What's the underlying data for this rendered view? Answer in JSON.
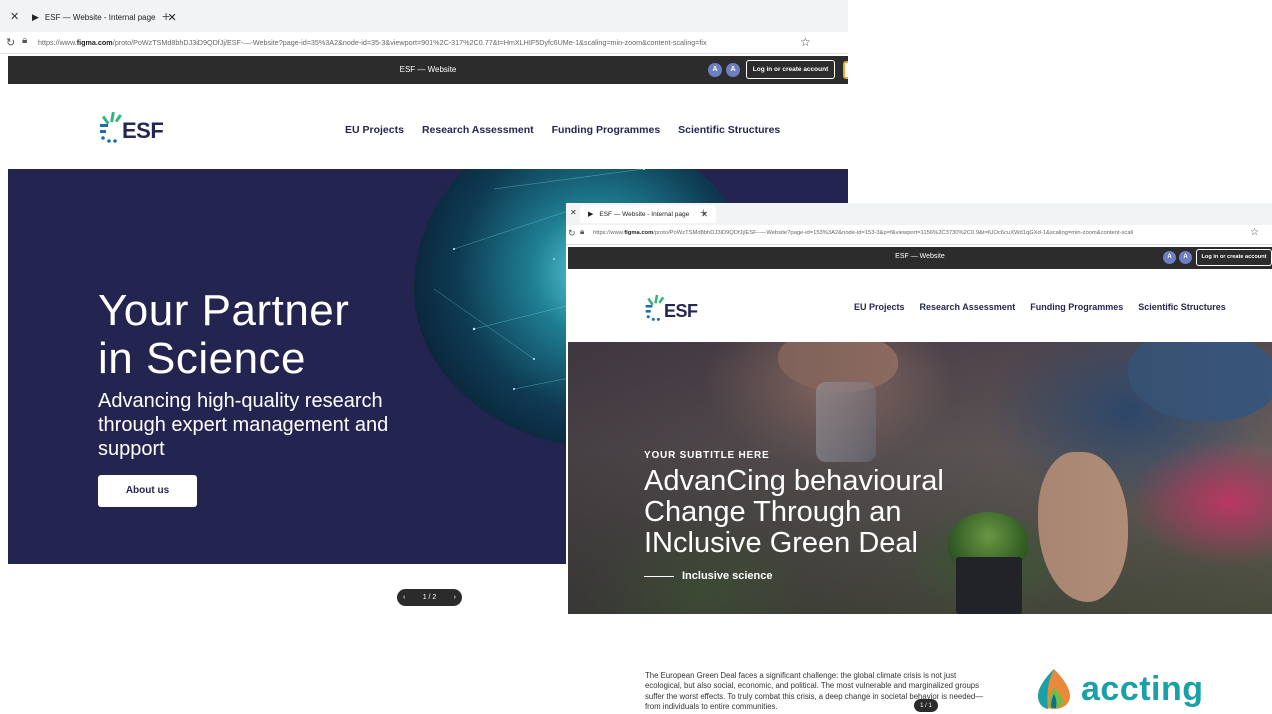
{
  "window1": {
    "tab_title": "ESF — Website - Internal page",
    "url_domain": "figma.com",
    "url_prefix": "https://www.",
    "url_rest": "/proto/PoWzTSMd8bhDJ3iD9QDfJj/ESF-—-Website?page-id=35%3A2&node-id=35-3&viewport=901%2C-317%2C0.77&t=HmXLHIF5Dyfc6UMe-1&scaling=min-zoom&content-scaling=fix",
    "figma_title": "ESF — Website",
    "avatars": [
      "A",
      "A"
    ],
    "login_label": "Log in or create account",
    "logo_text": "ESF",
    "nav": [
      "EU Projects",
      "Research Assessment",
      "Funding Programmes",
      "Scientific Structures"
    ],
    "hero_title_line1": "Your Partner",
    "hero_title_line2": "in Science",
    "hero_subtitle": "Advancing high-quality research through expert management and support",
    "about_button": "About us",
    "pager": "1 / 2"
  },
  "window2": {
    "tab_title": "ESF — Website - Internal page",
    "url_domain": "figma.com",
    "url_prefix": "https://www.",
    "url_rest": "/proto/PoWzTSMd8bhDJ3iD9QDfJj/ESF-—-Website?page-id=153%3A2&node-id=153-3&p=f&viewport=1156%2C3730%2C0.9&t=lUOc6cuXWd1qGXd-1&scaling=min-zoom&content-scali",
    "figma_title": "ESF — Website",
    "avatars": [
      "A",
      "A"
    ],
    "login_label": "Log in or create account",
    "logo_text": "ESF",
    "nav": [
      "EU Projects",
      "Research Assessment",
      "Funding Programmes",
      "Scientific Structures"
    ],
    "kicker": "YOUR SUBTITLE HERE",
    "hero_title_line1": "AdvanCing behavioural",
    "hero_title_line2": "Change Through an",
    "hero_title_line3": "INclusive Green Deal",
    "tagline": "Inclusive science"
  },
  "bottom": {
    "paragraph": "The European Green Deal faces a significant challenge: the global climate crisis is not just ecological, but also social, economic, and political. The most vulnerable and marginalized groups suffer the worst effects. To truly combat this crisis, a deep change in societal behavior is needed—from individuals to entire communities.",
    "pager": "1 / 1",
    "brand": "accting"
  },
  "colors": {
    "esf_navy": "#242450",
    "esf_green": "#35b37c",
    "esf_blue": "#1b6fa6",
    "accting_teal": "#1aa0a8",
    "figma_bar": "#2c2c2c"
  },
  "icons": [
    "close-icon",
    "play-icon",
    "plus-icon",
    "reload-icon",
    "lock-icon",
    "star-icon",
    "chevron-left-icon",
    "chevron-right-icon",
    "esf-logo-mark",
    "accting-logo-mark"
  ]
}
